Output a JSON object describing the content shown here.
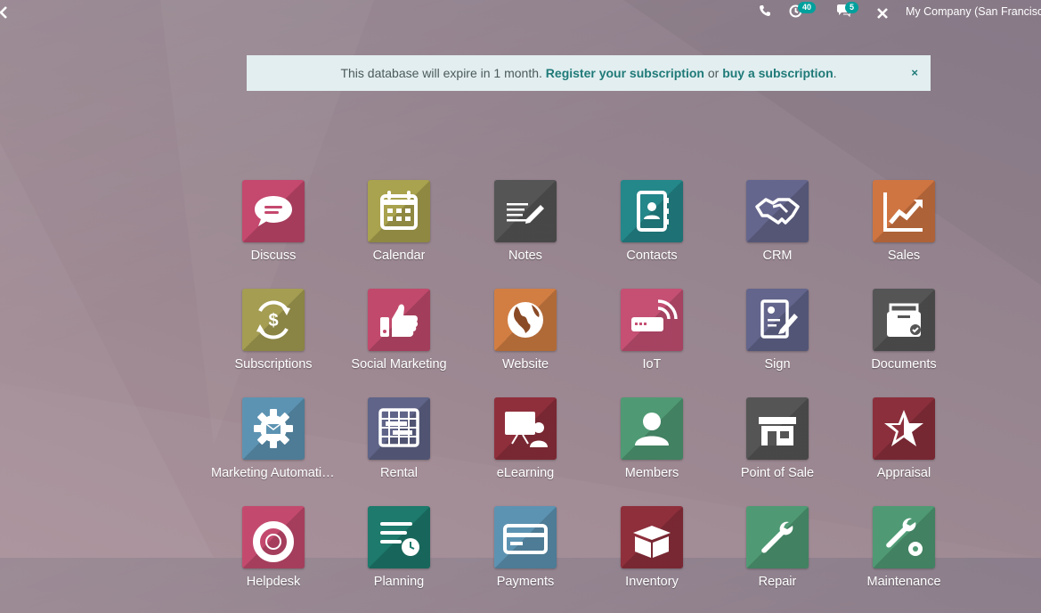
{
  "topbar": {
    "activity_count": "40",
    "messages_count": "5",
    "company": "My Company (San Francisco)"
  },
  "alert": {
    "text_before": "This database will expire in 1 month. ",
    "register_link": "Register your subscription",
    "text_middle": " or ",
    "buy_link": "buy a subscription",
    "text_after": ".",
    "close_symbol": "×"
  },
  "apps": [
    {
      "label": "Discuss",
      "icon": "chat-bubble-icon",
      "color": "#c5486e"
    },
    {
      "label": "Calendar",
      "icon": "calendar-icon",
      "color": "#a9a24e"
    },
    {
      "label": "Notes",
      "icon": "notes-pen-icon",
      "color": "#555555"
    },
    {
      "label": "Contacts",
      "icon": "address-book-icon",
      "color": "#24878a"
    },
    {
      "label": "CRM",
      "icon": "handshake-icon",
      "color": "#65668d"
    },
    {
      "label": "Sales",
      "icon": "trend-chart-icon",
      "color": "#cf7542"
    },
    {
      "label": "Subscriptions",
      "icon": "recurring-dollar-icon",
      "color": "#a49d52"
    },
    {
      "label": "Social Marketing",
      "icon": "thumbs-up-icon",
      "color": "#c14a6c"
    },
    {
      "label": "Website",
      "icon": "globe-icon",
      "color": "#d27e43"
    },
    {
      "label": "IoT",
      "icon": "iot-device-icon",
      "color": "#c55074"
    },
    {
      "label": "Sign",
      "icon": "sign-document-icon",
      "color": "#63658c"
    },
    {
      "label": "Documents",
      "icon": "document-box-icon",
      "color": "#555555"
    },
    {
      "label": "Marketing Automation",
      "icon": "gear-envelope-icon",
      "color": "#5d93b2"
    },
    {
      "label": "Rental",
      "icon": "rental-planner-icon",
      "color": "#5f6488"
    },
    {
      "label": "eLearning",
      "icon": "presentation-icon",
      "color": "#8f2f3c"
    },
    {
      "label": "Members",
      "icon": "user-icon",
      "color": "#4f9a74"
    },
    {
      "label": "Point of Sale",
      "icon": "shop-icon",
      "color": "#555555"
    },
    {
      "label": "Appraisal",
      "icon": "star-icon",
      "color": "#8c2f3c"
    },
    {
      "label": "Helpdesk",
      "icon": "lifebuoy-icon",
      "color": "#c34a6e"
    },
    {
      "label": "Planning",
      "icon": "planning-clock-icon",
      "color": "#1d7a6c"
    },
    {
      "label": "Payments",
      "icon": "credit-card-icon",
      "color": "#5d93b2"
    },
    {
      "label": "Inventory",
      "icon": "box-icon",
      "color": "#8f2f3c"
    },
    {
      "label": "Repair",
      "icon": "wrench-icon",
      "color": "#4f9a74"
    },
    {
      "label": "Maintenance",
      "icon": "wrench-gear-icon",
      "color": "#4f9a74"
    }
  ]
}
